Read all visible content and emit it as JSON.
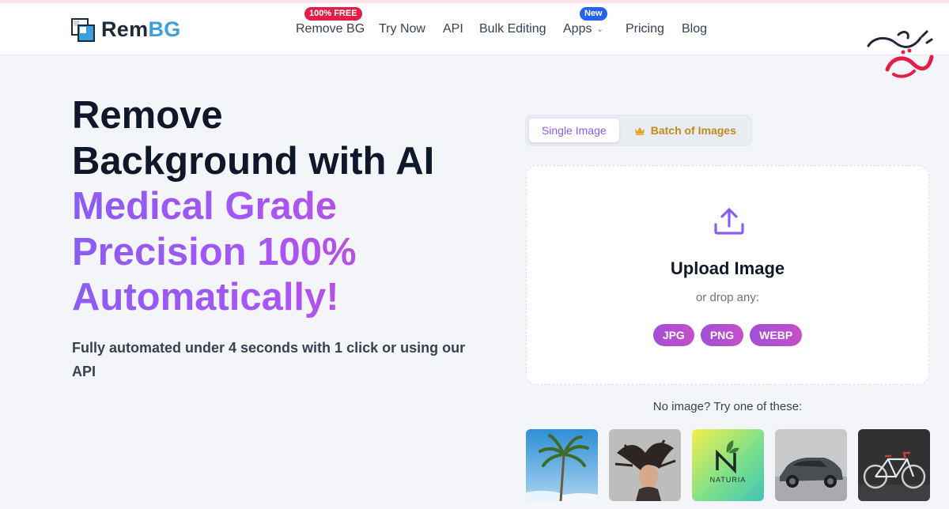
{
  "header": {
    "logo": {
      "part1": "Rem",
      "part2": "BG"
    },
    "nav": [
      {
        "label": "Remove BG",
        "badge": "100% FREE"
      },
      {
        "label": "Try Now"
      },
      {
        "label": "API"
      },
      {
        "label": "Bulk Editing"
      },
      {
        "label": "Apps",
        "badge": "New"
      },
      {
        "label": "Pricing"
      },
      {
        "label": "Blog"
      }
    ]
  },
  "hero": {
    "line1": "Remove",
    "line2": "Background with AI",
    "line3": "Medical Grade",
    "line4": "Precision 100%",
    "line5": "Automatically!",
    "subtitle": "Fully automated under 4 seconds with 1 click or using our API"
  },
  "tabs": {
    "single": "Single Image",
    "batch": "Batch of Images"
  },
  "upload": {
    "title": "Upload Image",
    "subtitle": "or drop any:",
    "formats": [
      "JPG",
      "PNG",
      "WEBP"
    ]
  },
  "samples": {
    "label": "No image? Try one of these:",
    "items": [
      "palm-tree",
      "woman-hair",
      "naturia-logo",
      "car",
      "bicycle"
    ],
    "naturia_text": "NATURIA"
  },
  "colors": {
    "accent_purple": "#8b5cf6",
    "gradient_end": "#c44fc9",
    "logo_blue": "#3b9fdc",
    "badge_red": "#e11d48",
    "badge_blue": "#2563eb",
    "batch_gold": "#c08a1e"
  }
}
